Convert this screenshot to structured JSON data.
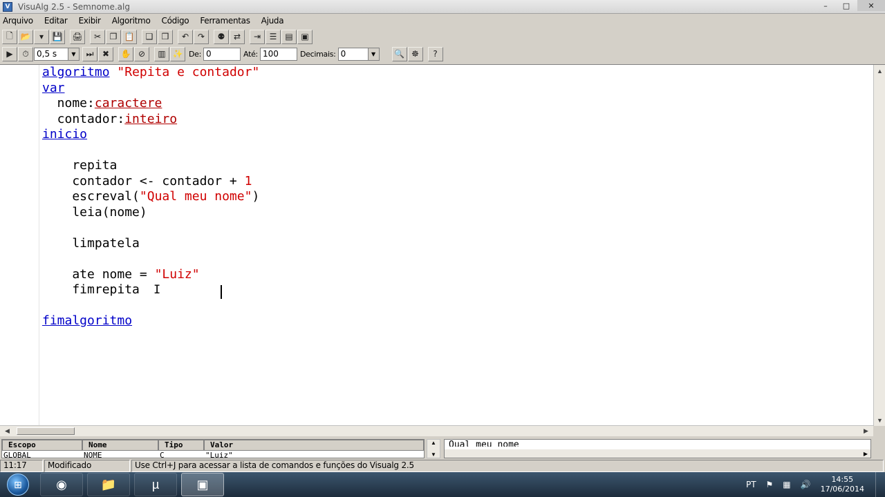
{
  "window": {
    "title": "VisuAlg 2.5 - Semnome.alg",
    "app_icon": "visualg-icon",
    "minimize": "–",
    "maximize": "□",
    "close": "✕"
  },
  "menu": [
    "Arquivo",
    "Editar",
    "Exibir",
    "Algoritmo",
    "Código",
    "Ferramentas",
    "Ajuda"
  ],
  "toolbar1": [
    {
      "name": "new-file-icon",
      "glyph": "🗋"
    },
    {
      "name": "open-folder-icon",
      "glyph": "📂"
    },
    {
      "name": "open-dropdown-icon",
      "glyph": "▾"
    },
    {
      "name": "save-icon",
      "glyph": "💾"
    },
    {
      "name": "sep"
    },
    {
      "name": "print-icon",
      "glyph": "🖨"
    },
    {
      "name": "sep"
    },
    {
      "name": "cut-icon",
      "glyph": "✂"
    },
    {
      "name": "copy-icon",
      "glyph": "❐"
    },
    {
      "name": "paste-icon",
      "glyph": "📋"
    },
    {
      "name": "sep"
    },
    {
      "name": "copy-as-icon",
      "glyph": "❑"
    },
    {
      "name": "paste-special-icon",
      "glyph": "❒"
    },
    {
      "name": "sep"
    },
    {
      "name": "undo-icon",
      "glyph": "↶"
    },
    {
      "name": "redo-icon",
      "glyph": "↷"
    },
    {
      "name": "sep"
    },
    {
      "name": "find-icon",
      "glyph": "⚉"
    },
    {
      "name": "replace-icon",
      "glyph": "⇄"
    },
    {
      "name": "sep"
    },
    {
      "name": "indent-icon",
      "glyph": "⇥"
    },
    {
      "name": "numbered-list-icon",
      "glyph": "☰"
    },
    {
      "name": "comment-icon",
      "glyph": "▤"
    },
    {
      "name": "template-icon",
      "glyph": "▣"
    }
  ],
  "toolbar2": {
    "run_icons": [
      {
        "name": "run-icon",
        "glyph": "▶"
      },
      {
        "name": "timer-icon",
        "glyph": "⏱"
      }
    ],
    "timer_value": "0,5 s",
    "step_icons": [
      {
        "name": "step-icon",
        "glyph": "⏭"
      },
      {
        "name": "stop-icon",
        "glyph": "✖"
      },
      {
        "name": "sep"
      },
      {
        "name": "breakpoint-icon",
        "glyph": "✋"
      },
      {
        "name": "clear-breakpoints-icon",
        "glyph": "⊘"
      },
      {
        "name": "sep"
      },
      {
        "name": "console-icon",
        "glyph": "▥"
      },
      {
        "name": "magic-wand-icon",
        "glyph": "✨"
      }
    ],
    "from_label": "De:",
    "from_value": "0",
    "to_label": "Até:",
    "to_value": "100",
    "decimals_label": "Decimais:",
    "decimals_value": "0",
    "end_icons": [
      {
        "name": "zoom-icon",
        "glyph": "🔍"
      },
      {
        "name": "bug-icon",
        "glyph": "☸"
      },
      {
        "name": "sep"
      },
      {
        "name": "help-icon",
        "glyph": "?"
      }
    ]
  },
  "code_lines": [
    [
      {
        "t": "algoritmo",
        "c": "kw"
      },
      {
        "t": " "
      },
      {
        "t": "\"Repita e contador\"",
        "c": "str"
      }
    ],
    [
      {
        "t": "var",
        "c": "kw"
      }
    ],
    [
      {
        "t": "  nome:"
      },
      {
        "t": "caractere",
        "c": "ty"
      }
    ],
    [
      {
        "t": "  contador:"
      },
      {
        "t": "inteiro",
        "c": "ty"
      }
    ],
    [
      {
        "t": "inicio",
        "c": "kw"
      }
    ],
    [],
    [
      {
        "t": "    repita"
      }
    ],
    [
      {
        "t": "    contador <- contador + "
      },
      {
        "t": "1",
        "c": "num"
      }
    ],
    [
      {
        "t": "    escreval("
      },
      {
        "t": "\"Qual meu nome\"",
        "c": "str"
      },
      {
        "t": ")"
      }
    ],
    [
      {
        "t": "    leia(nome)"
      }
    ],
    [],
    [
      {
        "t": "    limpatela"
      }
    ],
    [],
    [
      {
        "t": "    ate nome = "
      },
      {
        "t": "\"Luiz\"",
        "c": "str"
      }
    ],
    [
      {
        "t": "    fimrepita"
      }
    ],
    [],
    [
      {
        "t": "fimalgoritmo",
        "c": "kw"
      }
    ]
  ],
  "var_table": {
    "headers": [
      "Escopo",
      "Nome",
      "Tipo",
      "Valor"
    ],
    "row": [
      "GLOBAL",
      "NOME",
      "C",
      "\"Luiz\""
    ]
  },
  "output_text": "Qual meu nome",
  "status": {
    "position": "11:17",
    "state": "Modificado",
    "hint": "Use Ctrl+J para acessar a lista de comandos e funções do Visualg 2.5"
  },
  "taskbar": {
    "apps": [
      {
        "name": "chrome-icon",
        "glyph": "◉"
      },
      {
        "name": "file-explorer-icon",
        "glyph": "📁"
      },
      {
        "name": "utorrent-icon",
        "glyph": "µ"
      },
      {
        "name": "visualg-task-icon",
        "glyph": "▣"
      }
    ],
    "language": "PT",
    "time": "14:55",
    "date": "17/06/2014"
  }
}
